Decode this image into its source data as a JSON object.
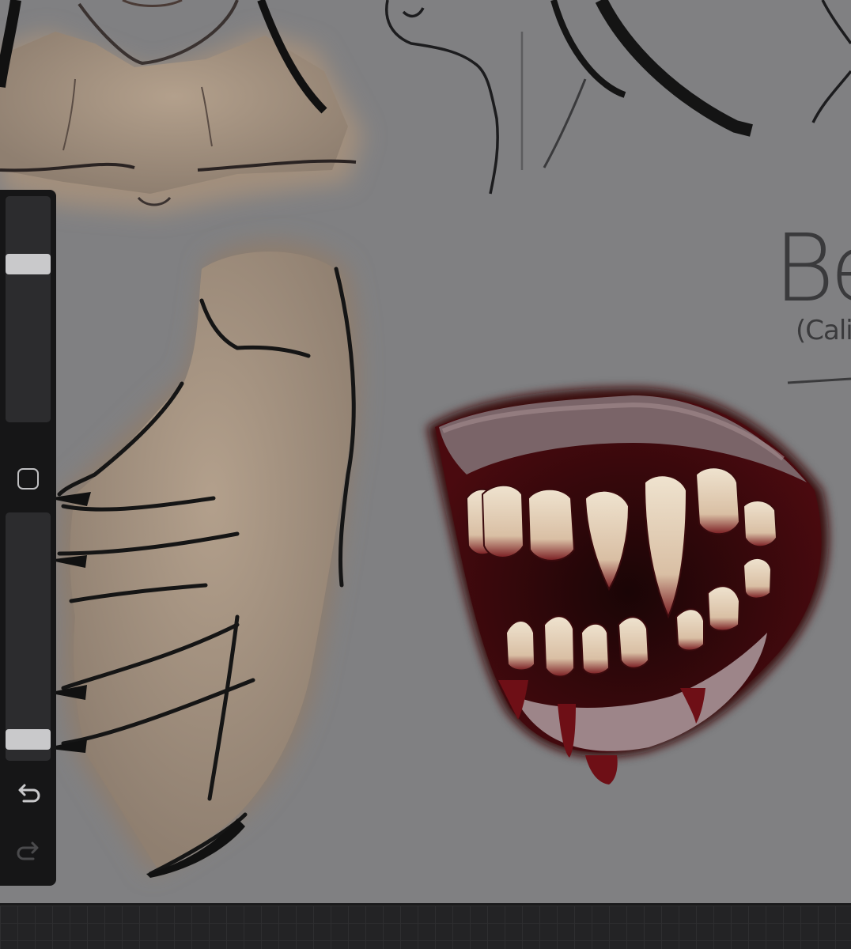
{
  "canvas": {
    "background_color": "#808082",
    "handwritten_title": "Be",
    "handwritten_subtitle": "(Cali"
  },
  "sidebar": {
    "brush_size_level": 0.72,
    "brush_opacity_level": 0.05,
    "modify_icon": "square-outline-icon",
    "undo_icon": "undo-arrow-icon",
    "redo_icon": "redo-arrow-icon"
  },
  "colors": {
    "skin": "#a89583",
    "hair": "#141414",
    "blood": "#6e0f16",
    "ui_panel": "#161617",
    "slider_thumb": "#c9c9cb"
  }
}
